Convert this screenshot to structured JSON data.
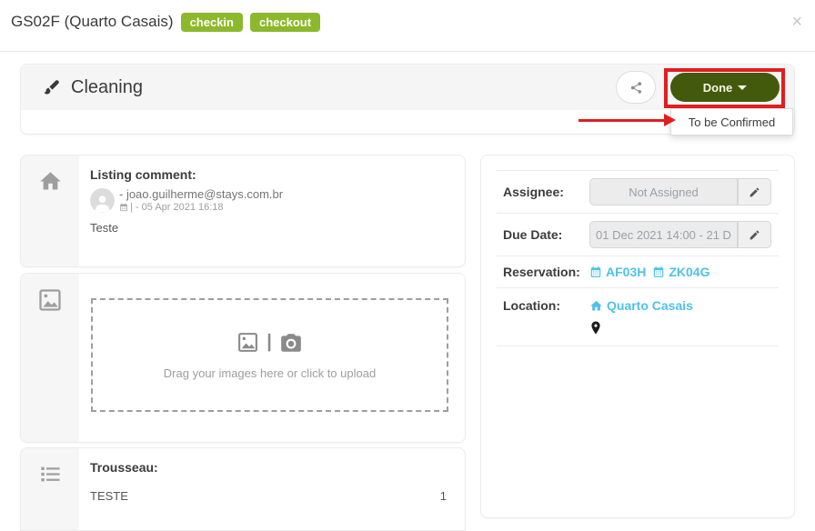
{
  "colors": {
    "badge_green": "#8cb82b",
    "status_button_green": "#435a0c",
    "link_cyan": "#4fc1e9",
    "annotation_red": "#e01e20"
  },
  "header": {
    "title": "GS02F (Quarto Casais)",
    "badges": [
      {
        "label": "checkin"
      },
      {
        "label": "checkout"
      }
    ],
    "close_glyph": "×"
  },
  "task": {
    "title": "Cleaning",
    "status_button_label": "Done",
    "status_dropdown": {
      "items": [
        {
          "label": "To be Confirmed"
        }
      ]
    }
  },
  "listing_comment": {
    "title": "Listing comment:",
    "author": "- joao.guilherme@stays.com.br",
    "timestamp": "| - 05 Apr 2021 16:18",
    "body": "Teste"
  },
  "uploader": {
    "divider_glyph": "|",
    "hint": "Drag your images here or click to upload"
  },
  "trousseau": {
    "title": "Trousseau:",
    "items": [
      {
        "name": "TESTE",
        "quantity": "1"
      }
    ]
  },
  "details": {
    "assignee": {
      "label": "Assignee:",
      "value": "Not Assigned"
    },
    "due_date": {
      "label": "Due Date:",
      "value": "01 Dec 2021 14:00 - 21 D"
    },
    "reservation": {
      "label": "Reservation:",
      "links": [
        {
          "code": "AF03H"
        },
        {
          "code": "ZK04G"
        }
      ]
    },
    "location": {
      "label": "Location:",
      "value": "Quarto Casais"
    }
  }
}
